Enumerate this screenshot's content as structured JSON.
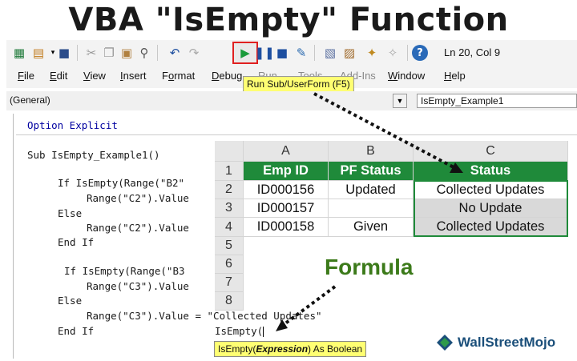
{
  "title": "VBA \"IsEmpty\" Function",
  "toolbar": {
    "icons": [
      "excel-icon",
      "insert-userform-icon",
      "save-icon",
      "cut-icon",
      "copy-icon",
      "paste-icon",
      "find-icon",
      "undo-icon",
      "redo-icon",
      "run-icon",
      "break-icon",
      "reset-icon",
      "design-mode-icon",
      "project-explorer-icon",
      "properties-icon",
      "object-browser-icon",
      "toolbox-icon",
      "help-icon"
    ],
    "position": "Ln 20, Col 9"
  },
  "menu": [
    {
      "label": "File",
      "u": "F",
      "rest": "ile"
    },
    {
      "label": "Edit",
      "u": "E",
      "rest": "dit"
    },
    {
      "label": "View",
      "u": "V",
      "rest": "iew"
    },
    {
      "label": "Insert",
      "u": "I",
      "rest": "nsert"
    },
    {
      "label": "Format",
      "u": "o",
      "pre": "F",
      "rest": "rmat"
    },
    {
      "label": "Debug",
      "u": "D",
      "rest": "ebug"
    },
    {
      "label": "Run",
      "u": "R",
      "rest": "un"
    },
    {
      "label": "Tools",
      "u": "T",
      "rest": "ools"
    },
    {
      "label": "Add-Ins",
      "u": "A",
      "rest": "dd-Ins"
    },
    {
      "label": "Window",
      "u": "W",
      "rest": "indow"
    },
    {
      "label": "Help",
      "u": "H",
      "rest": "elp"
    }
  ],
  "run_tooltip": "Run Sub/UserForm (F5)",
  "object_combo": "(General)",
  "procedure_combo": "IsEmpty_Example1",
  "code": {
    "option_explicit": "Option Explicit",
    "sub_line": "Sub IsEmpty_Example1()",
    "if1": "If IsEmpty(Range(\"B2\"",
    "range_c2_a": "Range(\"C2\").Value",
    "else1": "Else",
    "range_c2_b": "Range(\"C2\").Value",
    "endif1": "End If",
    "if2": "If IsEmpty(Range(\"B3",
    "range_c3_a": "Range(\"C3\").Value",
    "else2": "Else",
    "range_c3_b": "Range(\"C3\").Value = \"Collected Updates\"",
    "endif2": "End If",
    "typing": "IsEmpty("
  },
  "syntax_tooltip": {
    "pre": "IsEmpty(",
    "arg": "Expression",
    "post": ") As Boolean"
  },
  "sheet": {
    "columns": [
      "A",
      "B",
      "C"
    ],
    "rows": [
      "1",
      "2",
      "3",
      "4",
      "5",
      "6",
      "7",
      "8"
    ],
    "header": [
      "Emp ID",
      "PF Status",
      "Status"
    ],
    "data": [
      [
        "ID000156",
        "Updated",
        "Collected Updates"
      ],
      [
        "ID000157",
        "",
        "No Update"
      ],
      [
        "ID000158",
        "Given",
        "Collected Updates"
      ]
    ]
  },
  "formula_label": "Formula",
  "logo": "WallStreetMojo",
  "colors": {
    "header_green": "#1f8a3a",
    "formula_green": "#3c7a1a",
    "tooltip_yellow": "#ffff73",
    "run_highlight": "#e02020"
  }
}
